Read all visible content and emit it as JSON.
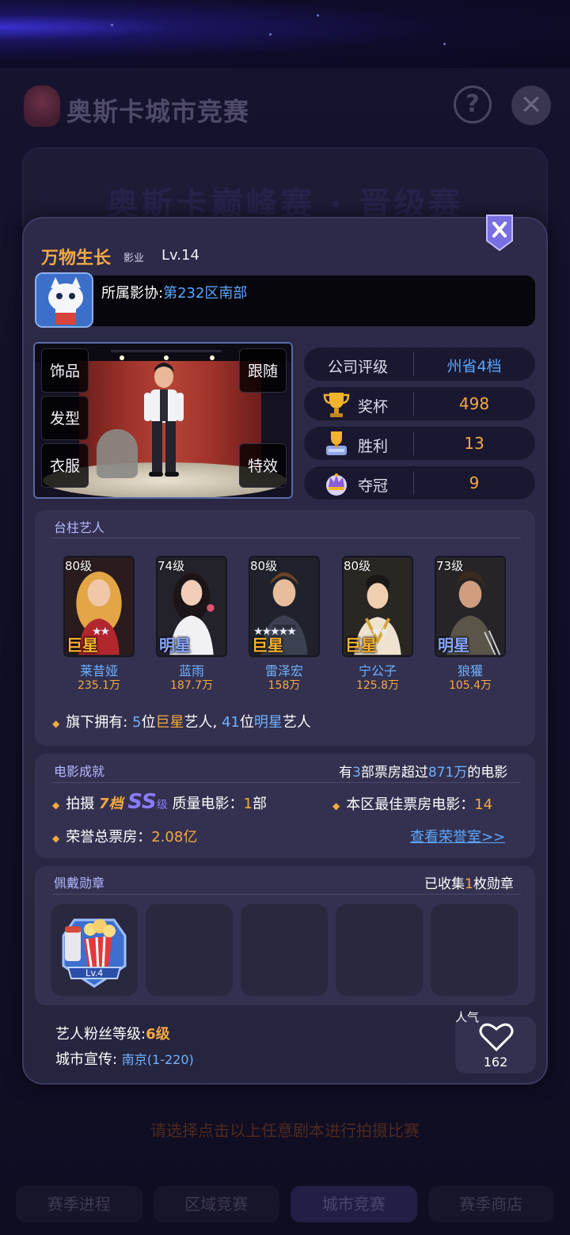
{
  "background": {
    "title": "奥斯卡城市竞赛",
    "help_icon": "?",
    "close_icon": "✕",
    "banner": "奥斯卡巅峰赛 · 晋级赛",
    "hint": "请选择点击以上任意剧本进行拍摄比赛",
    "tabs": [
      "赛季进程",
      "区域竞赛",
      "城市竞赛",
      "赛季商店"
    ]
  },
  "profile": {
    "name": "万物生长",
    "type": "影业",
    "level": "Lv.14",
    "guild_label": "所属影协:",
    "guild_value": "第232区南部"
  },
  "stage_buttons": {
    "accessories": "饰品",
    "follow": "跟随",
    "hairstyle": "发型",
    "clothes": "衣服",
    "effects": "特效"
  },
  "stats": {
    "rating_label": "公司评级",
    "rating_value": "州省4档",
    "trophy_label": "奖杯",
    "trophy_value": "498",
    "wins_label": "胜利",
    "wins_value": "13",
    "champion_label": "夺冠",
    "champion_value": "9"
  },
  "artists_section": {
    "title": "台柱艺人",
    "artists": [
      {
        "level": "80级",
        "rank": "巨星",
        "stars": "★★",
        "name": "莱昔娅",
        "fans": "235.1万"
      },
      {
        "level": "74级",
        "rank": "明星",
        "stars": "",
        "name": "蓝雨",
        "fans": "187.7万"
      },
      {
        "level": "80级",
        "rank": "巨星",
        "stars": "★★★★★",
        "name": "雷泽宏",
        "fans": "158万"
      },
      {
        "level": "80级",
        "rank": "巨星",
        "stars": "★★",
        "name": "宁公子",
        "fans": "125.8万"
      },
      {
        "level": "73级",
        "rank": "明星",
        "stars": "",
        "name": "狼獾",
        "fans": "105.4万"
      }
    ],
    "summary": {
      "prefix": "旗下拥有: ",
      "superstar_count": "5",
      "mid1": "位",
      "superstar": "巨星",
      "mid2": "艺人, ",
      "star_count": "41",
      "mid3": "位",
      "star": "明星",
      "suffix": "艺人"
    }
  },
  "movie_section": {
    "title": "电影成就",
    "right_prefix": "有",
    "right_count": "3",
    "right_mid": "部票房超过",
    "right_amount": "871万",
    "right_suffix": "的电影",
    "shoot_label": "拍摄",
    "shoot_tier": "7档",
    "shoot_grade": "SS",
    "shoot_grade_suffix": "级",
    "shoot_quality": "质量电影：",
    "shoot_count": "1",
    "shoot_unit": "部",
    "best_label": "本区最佳票房电影：",
    "best_value": "14",
    "total_label": "荣誉总票房：",
    "total_value": "2.08亿",
    "honor_link": "查看荣誉室>>"
  },
  "badge_section": {
    "title": "佩戴勋章",
    "right_prefix": "已收集",
    "right_count": "1",
    "right_suffix": "枚勋章",
    "badge_level": "Lv.4"
  },
  "footer": {
    "fan_label": "艺人粉丝等级:",
    "fan_value": "6级",
    "city_label": "城市宣传: ",
    "city_value": "南京(1-220)",
    "popularity_label": "人气",
    "popularity_value": "162"
  }
}
